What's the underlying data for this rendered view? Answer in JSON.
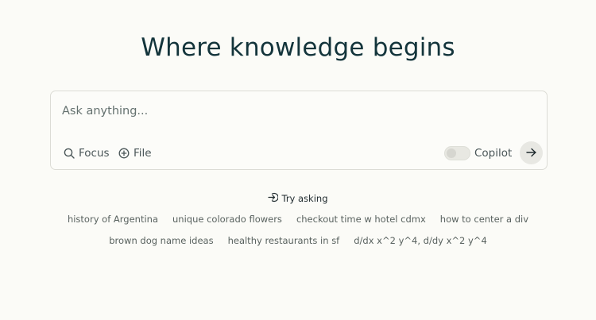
{
  "headline": "Where knowledge begins",
  "ask": {
    "placeholder": "Ask anything...",
    "focus_label": "Focus",
    "file_label": "File",
    "copilot_label": "Copilot",
    "copilot_enabled": false
  },
  "try_asking": {
    "label": "Try asking",
    "suggestions_row1": [
      "history of Argentina",
      "unique colorado flowers",
      "checkout time w hotel cdmx",
      "how to center a div"
    ],
    "suggestions_row2": [
      "brown dog name ideas",
      "healthy restaurants in sf",
      "d/dx x^2 y^4, d/dy x^2 y^4"
    ]
  },
  "icons": {
    "focus": "search-icon",
    "file": "plus-circle-icon",
    "submit": "arrow-right-icon",
    "try_asking": "sign-in-arrow-icon"
  },
  "colors": {
    "background": "#fbfbf7",
    "headline": "#13343b",
    "border": "#dcdcd6"
  }
}
